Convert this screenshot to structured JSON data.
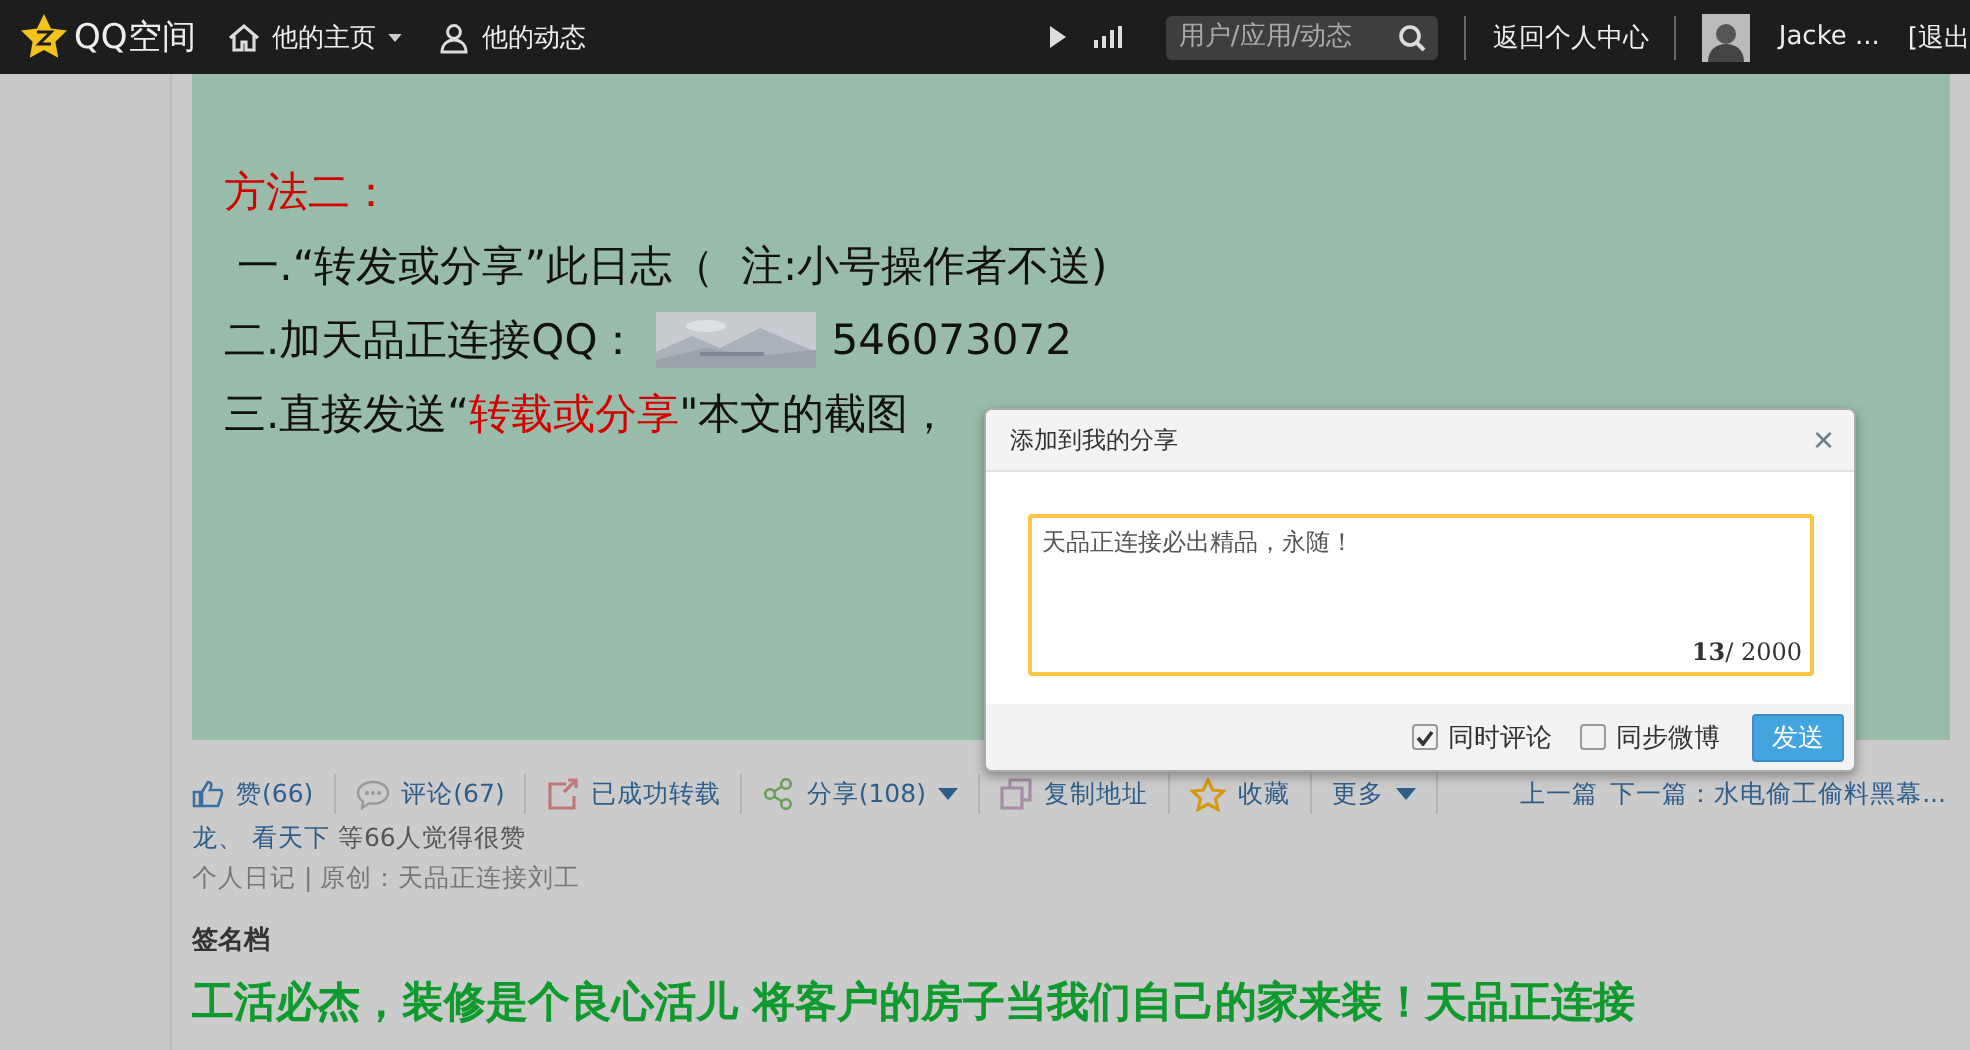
{
  "topbar": {
    "logo": "QQ空间",
    "nav": [
      {
        "label": "他的主页",
        "dropdown": true
      },
      {
        "label": "他的动态",
        "dropdown": false
      }
    ],
    "search": {
      "placeholder": "用户/应用/动态"
    },
    "links": [
      "返回个人中心"
    ],
    "user": "Jacke ...",
    "logout": "[退出"
  },
  "article": {
    "lines": [
      {
        "kind": "heading",
        "text": "方法二："
      },
      {
        "kind": "plain",
        "text": " 一.“转发或分享”此日志（  注:小号操作者不送)"
      },
      {
        "kind": "qq",
        "text": "二.加天品正连接QQ：",
        "number": "546073072"
      },
      {
        "kind": "highlight",
        "before": "三.直接发送“",
        "highlight": "转载或分享",
        "after": "\"本文的截图，"
      }
    ]
  },
  "actions": [
    {
      "kind": "like",
      "label": "赞(66)",
      "dropdown": false
    },
    {
      "kind": "comment",
      "label": "评论(67)",
      "dropdown": false
    },
    {
      "kind": "repost",
      "label": "已成功转载",
      "dropdown": false
    },
    {
      "kind": "share",
      "label": "分享(108)",
      "dropdown": true
    },
    {
      "kind": "copy",
      "label": "复制地址",
      "dropdown": false
    },
    {
      "kind": "favorite",
      "label": "收藏",
      "dropdown": false
    },
    {
      "kind": "more",
      "label": "更多",
      "dropdown": true
    }
  ],
  "post_nav": [
    "上一篇",
    "下一篇：水电偷工偷料黑幕..."
  ],
  "likes": {
    "names": "龙、 看天下",
    "text": "等66人觉得很赞"
  },
  "meta": "个人日记 | 原创：天品正连接刘工",
  "signature": {
    "label": "签名档",
    "text": "工活必杰，装修是个良心活儿 将客户的房子当我们自己的家来装！天品正连接"
  },
  "dialog": {
    "title": "添加到我的分享",
    "close": "×",
    "value": "天品正连接必出精品，永随！",
    "count": "13",
    "total": "/ 2000",
    "options": [
      {
        "label": "同时评论",
        "checked": true
      },
      {
        "label": "同步微博",
        "checked": false
      }
    ],
    "button": "发送"
  }
}
